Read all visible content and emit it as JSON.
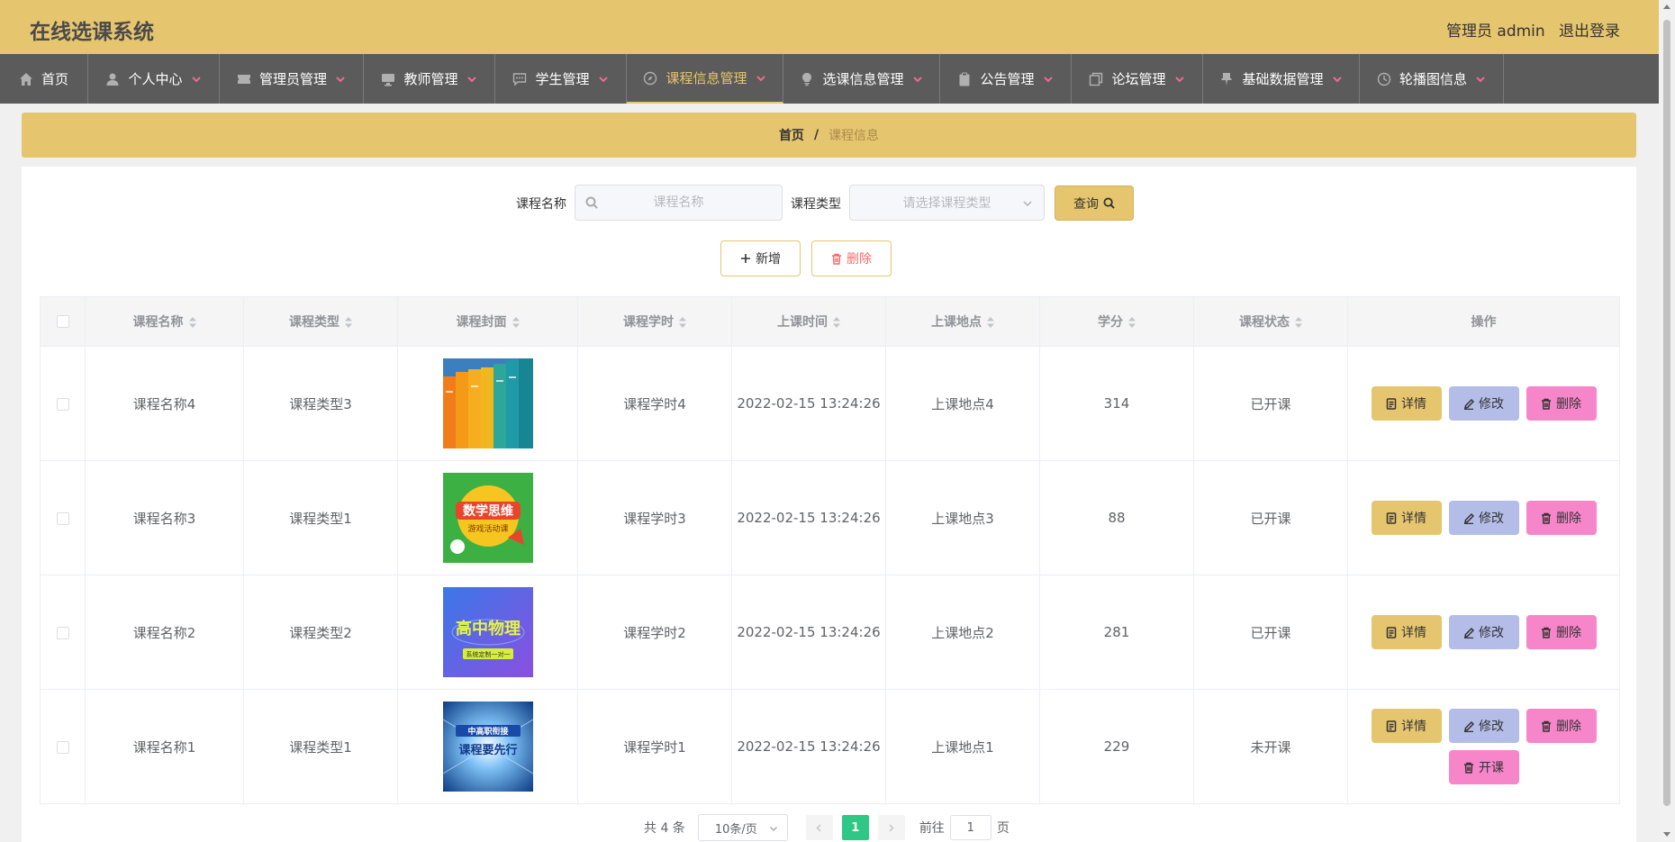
{
  "header": {
    "title": "在线选课系统",
    "admin": "管理员 admin",
    "logout": "退出登录"
  },
  "nav": [
    {
      "label": "首页",
      "icon": "home-icon"
    },
    {
      "label": "个人中心",
      "icon": "user-icon"
    },
    {
      "label": "管理员管理",
      "icon": "ticket-icon"
    },
    {
      "label": "教师管理",
      "icon": "monitor-icon"
    },
    {
      "label": "学生管理",
      "icon": "chat-icon"
    },
    {
      "label": "课程信息管理",
      "icon": "compass-icon"
    },
    {
      "label": "选课信息管理",
      "icon": "bulb-icon"
    },
    {
      "label": "公告管理",
      "icon": "clipboard-icon"
    },
    {
      "label": "论坛管理",
      "icon": "copy-icon"
    },
    {
      "label": "基础数据管理",
      "icon": "pin-icon"
    },
    {
      "label": "轮播图信息",
      "icon": "clock-icon"
    }
  ],
  "breadcrumb": {
    "home": "首页",
    "sep": "/",
    "current": "课程信息"
  },
  "search": {
    "name_label": "课程名称",
    "name_placeholder": "课程名称",
    "type_label": "课程类型",
    "type_placeholder": "请选择课程类型",
    "query": "查询"
  },
  "actions": {
    "add": "新增",
    "delete": "删除"
  },
  "table": {
    "headers": [
      "课程名称",
      "课程类型",
      "课程封面",
      "课程学时",
      "上课时间",
      "上课地点",
      "学分",
      "课程状态",
      "操作"
    ],
    "rows": [
      {
        "name": "课程名称4",
        "type": "课程类型3",
        "cover": "books-cover",
        "hours": "课程学时4",
        "time": "2022-02-15 13:24:26",
        "place": "上课地点4",
        "credit": "314",
        "status": "已开课"
      },
      {
        "name": "课程名称3",
        "type": "课程类型1",
        "cover": "math-cover",
        "hours": "课程学时3",
        "time": "2022-02-15 13:24:26",
        "place": "上课地点3",
        "credit": "88",
        "status": "已开课"
      },
      {
        "name": "课程名称2",
        "type": "课程类型2",
        "cover": "physics-cover",
        "hours": "课程学时2",
        "time": "2022-02-15 13:24:26",
        "place": "上课地点2",
        "credit": "281",
        "status": "已开课"
      },
      {
        "name": "课程名称1",
        "type": "课程类型1",
        "cover": "tech-cover",
        "hours": "课程学时1",
        "time": "2022-02-15 13:24:26",
        "place": "上课地点1",
        "credit": "229",
        "status": "未开课"
      }
    ],
    "op_labels": {
      "detail": "详情",
      "edit": "修改",
      "delete": "删除",
      "open": "开课"
    }
  },
  "covers": {
    "math_title": "数学思维",
    "math_sub": "游戏活动课",
    "physics_title": "高中物理",
    "physics_sub": "系统定制一对一",
    "tech_title_1": "中高职衔接",
    "tech_title_2": "课程要先行"
  },
  "pager": {
    "total": "共 4 条",
    "size": "10条/页",
    "page": "1",
    "goto": "前往",
    "goto_value": "1",
    "page_unit": "页"
  },
  "colors": {
    "accent": "#e6c56f",
    "nav_bg": "#5b5b5b",
    "edit": "#b4bde8",
    "delete": "#f685ca",
    "current_page": "#2fc785"
  }
}
